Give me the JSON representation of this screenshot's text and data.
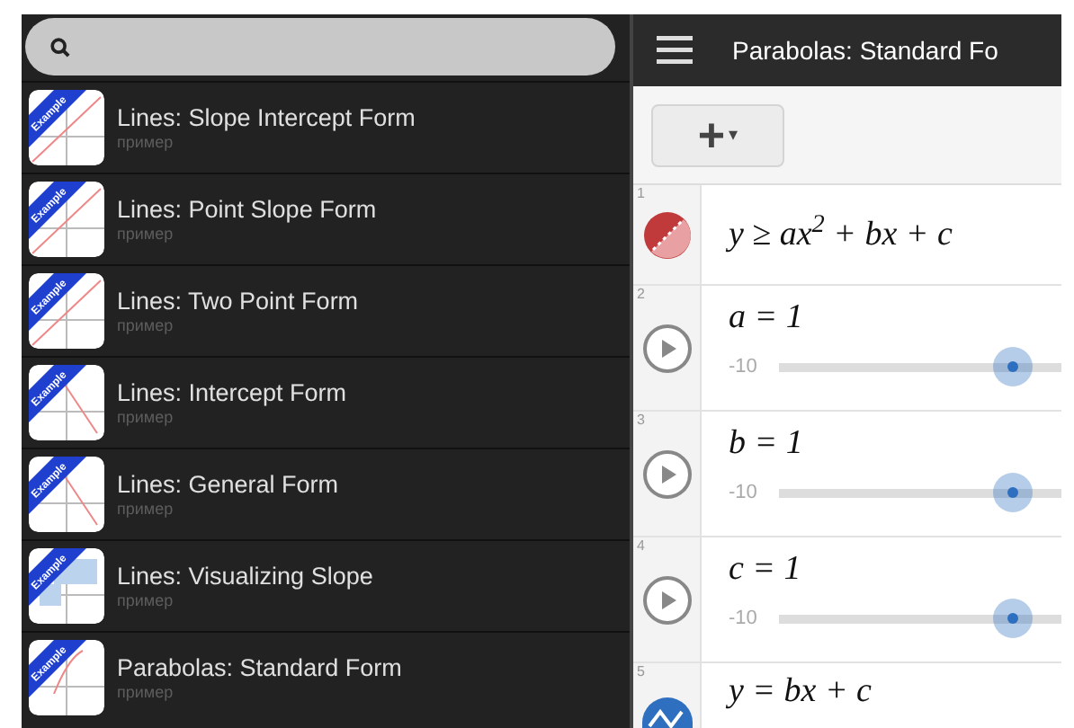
{
  "sidebar": {
    "items": [
      {
        "title": "Lines: Slope Intercept Form",
        "subtitle": "пример",
        "ribbon": "Example",
        "selected": false
      },
      {
        "title": "Lines: Point Slope Form",
        "subtitle": "пример",
        "ribbon": "Example",
        "selected": false
      },
      {
        "title": "Lines: Two Point Form",
        "subtitle": "пример",
        "ribbon": "Example",
        "selected": false
      },
      {
        "title": "Lines: Intercept Form",
        "subtitle": "пример",
        "ribbon": "Example",
        "selected": false
      },
      {
        "title": "Lines: General Form",
        "subtitle": "пример",
        "ribbon": "Example",
        "selected": false
      },
      {
        "title": "Lines: Visualizing Slope",
        "subtitle": "пример",
        "ribbon": "Example",
        "selected": false
      },
      {
        "title": "Parabolas: Standard Form",
        "subtitle": "пример",
        "ribbon": "Example",
        "selected": false
      }
    ]
  },
  "header": {
    "title": "Parabolas: Standard Fo"
  },
  "toolbar": {
    "add_label": "+",
    "caret": "▾"
  },
  "expressions": [
    {
      "number": "1",
      "kind": "inequality",
      "formula": "y ≥ ax$^{2}$ + bx + c",
      "color": "#c0393b"
    },
    {
      "number": "2",
      "kind": "slider",
      "formula": "a = 1",
      "min": "-10",
      "level": 0.83
    },
    {
      "number": "3",
      "kind": "slider",
      "formula": "b = 1",
      "min": "-10",
      "level": 0.83
    },
    {
      "number": "4",
      "kind": "slider",
      "formula": "c = 1",
      "min": "-10",
      "level": 0.83
    },
    {
      "number": "5",
      "kind": "function",
      "formula": "y = bx + c",
      "color": "#2f6fc0"
    }
  ]
}
